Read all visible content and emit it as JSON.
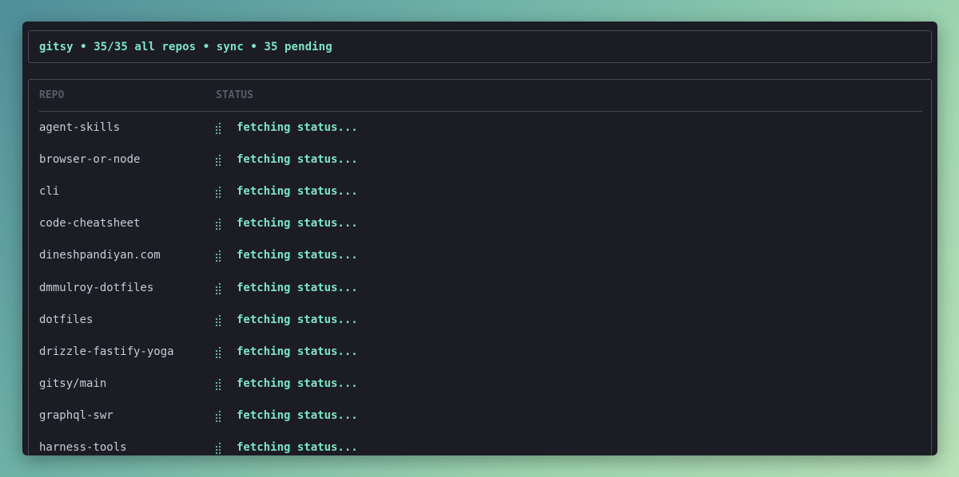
{
  "header": {
    "text": "gitsy • 35/35 all repos • sync • 35 pending"
  },
  "table": {
    "columns": {
      "repo": "REPO",
      "status": "STATUS"
    },
    "rows": [
      {
        "repo": "agent-skills",
        "status": "fetching status..."
      },
      {
        "repo": "browser-or-node",
        "status": "fetching status..."
      },
      {
        "repo": "cli",
        "status": "fetching status..."
      },
      {
        "repo": "code-cheatsheet",
        "status": "fetching status..."
      },
      {
        "repo": "dineshpandiyan.com",
        "status": "fetching status..."
      },
      {
        "repo": "dmmulroy-dotfiles",
        "status": "fetching status..."
      },
      {
        "repo": "dotfiles",
        "status": "fetching status..."
      },
      {
        "repo": "drizzle-fastify-yoga",
        "status": "fetching status..."
      },
      {
        "repo": "gitsy/main",
        "status": "fetching status..."
      },
      {
        "repo": "graphql-swr",
        "status": "fetching status..."
      },
      {
        "repo": "harness-tools",
        "status": "fetching status..."
      }
    ]
  },
  "icons": {
    "spinner": "braille-spinner-icon"
  },
  "colors": {
    "accent": "#7ee6c2",
    "text": "#c9cbd6",
    "muted": "#5b5b69",
    "panel": "#1c1c25",
    "border": "#4a4a57"
  }
}
